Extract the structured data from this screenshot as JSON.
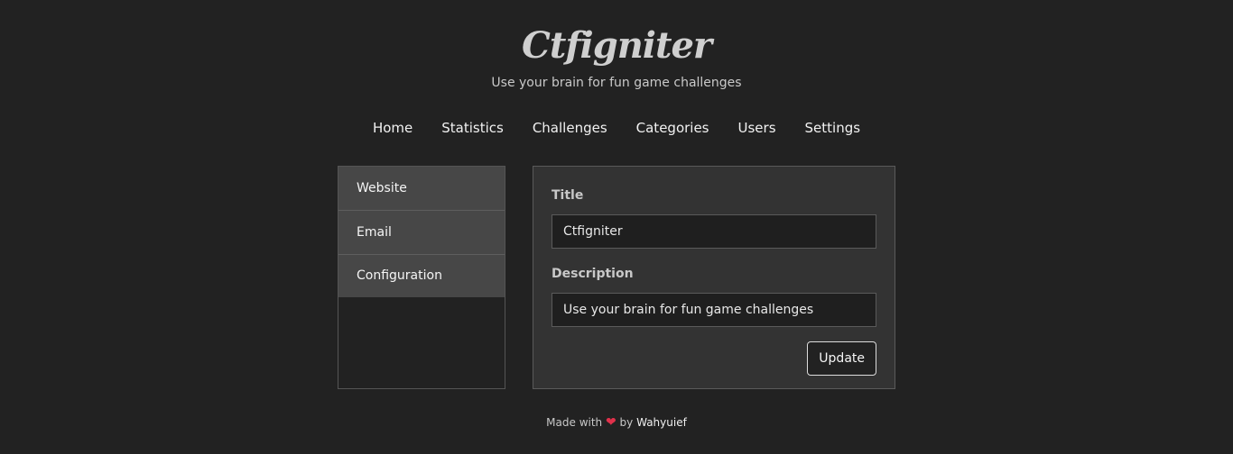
{
  "site": {
    "title": "Ctfigniter",
    "tagline": "Use your brain for fun game challenges"
  },
  "nav": [
    {
      "label": "Home"
    },
    {
      "label": "Statistics"
    },
    {
      "label": "Challenges"
    },
    {
      "label": "Categories"
    },
    {
      "label": "Users"
    },
    {
      "label": "Settings"
    }
  ],
  "sidebar": {
    "items": [
      {
        "label": "Website"
      },
      {
        "label": "Email"
      },
      {
        "label": "Configuration"
      }
    ]
  },
  "form": {
    "title_label": "Title",
    "title_value": "Ctfigniter",
    "description_label": "Description",
    "description_value": "Use your brain for fun game challenges",
    "update_label": "Update"
  },
  "footer": {
    "made_with": "Made with",
    "heart_icon": "heart-icon",
    "by": "by",
    "author": "Wahyuief"
  },
  "colors": {
    "background": "#222222",
    "panel": "#333333",
    "sidebar": "#474747",
    "heart": "#e0314b"
  }
}
